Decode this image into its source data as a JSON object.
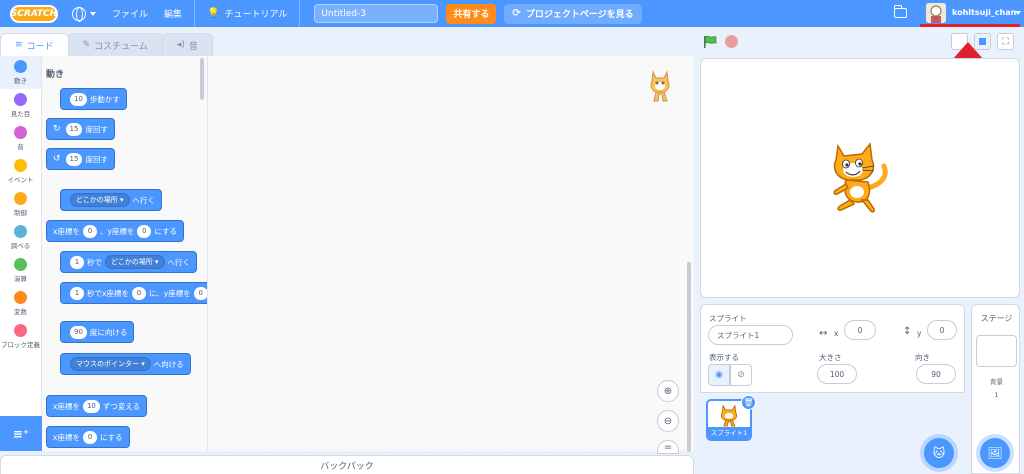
{
  "menubar": {
    "logo": "SCRATCH",
    "file": "ファイル",
    "edit": "編集",
    "tutorial": "チュートリアル",
    "project_title": "Untitled-3",
    "share": "共有する",
    "project_page": "プロジェクトページを見る",
    "username": "kohitsuji_chan"
  },
  "tabs": {
    "code": "コード",
    "costume": "コスチューム",
    "sound": "音"
  },
  "categories": [
    {
      "label": "動き",
      "color": "#4c97ff"
    },
    {
      "label": "見た目",
      "color": "#9966ff"
    },
    {
      "label": "音",
      "color": "#cf63cf"
    },
    {
      "label": "イベント",
      "color": "#ffbf00"
    },
    {
      "label": "制御",
      "color": "#ffab19"
    },
    {
      "label": "調べる",
      "color": "#5cb1d6"
    },
    {
      "label": "演算",
      "color": "#59c059"
    },
    {
      "label": "変数",
      "color": "#ff8c1a"
    },
    {
      "label": "ブロック定義",
      "color": "#ff6680"
    }
  ],
  "palette": {
    "heading": "動き",
    "move": {
      "value": "10",
      "text": "歩動かす"
    },
    "turn_right": {
      "value": "15",
      "text": "度回す"
    },
    "turn_left": {
      "value": "15",
      "text": "度回す"
    },
    "goto": {
      "menu": "どこかの場所",
      "text": "へ行く"
    },
    "goto_xy": {
      "t1": "x座標を",
      "x": "0",
      "t2": "、y座標を",
      "y": "0",
      "t3": "にする"
    },
    "glide_to": {
      "secs": "1",
      "t1": "秒で",
      "menu": "どこかの場所",
      "t2": "へ行く"
    },
    "glide_xy": {
      "secs": "1",
      "t1": "秒でx座標を",
      "x": "0",
      "t2": "に、y座標を",
      "y": "0"
    },
    "point_dir": {
      "value": "90",
      "text": "度に向ける"
    },
    "point_towards": {
      "menu": "マウスのポインター",
      "text": "へ向ける"
    },
    "change_x": {
      "t1": "x座標を",
      "value": "10",
      "t2": "ずつ変える"
    },
    "set_x": {
      "t1": "x座標を",
      "value": "0",
      "t2": "にする"
    }
  },
  "backpack": "バックパック",
  "sprite_info": {
    "sprite_label": "スプライト",
    "sprite_name": "スプライト1",
    "x_label": "x",
    "x_value": "0",
    "y_label": "y",
    "y_value": "0",
    "show_label": "表示する",
    "size_label": "大きさ",
    "size_value": "100",
    "direction_label": "向き",
    "direction_value": "90"
  },
  "sprite_tile": {
    "name": "スプライト1"
  },
  "stage_target": {
    "title": "ステージ",
    "backdrops_label": "背景",
    "backdrops_count": "1"
  },
  "colors": {
    "menu_blue": "#4c97ff",
    "share_orange": "#ff8c1a",
    "annotation_red": "#e0202a"
  },
  "icons": [
    "globe-icon",
    "tutorial-icon",
    "remix-icon",
    "folder-icon",
    "green-flag-icon",
    "stop-icon",
    "zoom-in-icon",
    "zoom-out-icon",
    "eye-icon",
    "hidden-eye-icon",
    "trash-icon",
    "choose-sprite-icon",
    "choose-backdrop-icon",
    "extension-icon",
    "arrow-annotation-icon"
  ]
}
